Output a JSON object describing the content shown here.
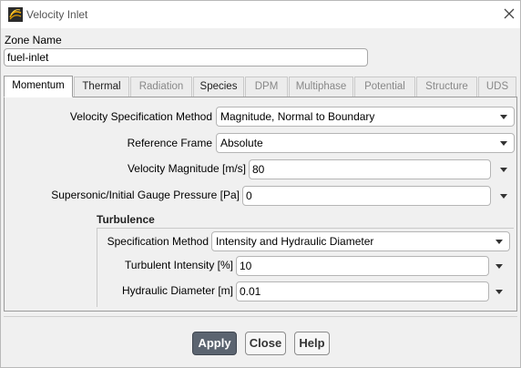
{
  "window": {
    "title": "Velocity Inlet",
    "icon": "fluent-app-icon",
    "close_icon": "close-icon"
  },
  "zone": {
    "label": "Zone Name",
    "value": "fuel-inlet"
  },
  "tabs": [
    {
      "label": "Momentum",
      "state": "active"
    },
    {
      "label": "Thermal",
      "state": "enabled"
    },
    {
      "label": "Radiation",
      "state": "disabled"
    },
    {
      "label": "Species",
      "state": "enabled"
    },
    {
      "label": "DPM",
      "state": "disabled"
    },
    {
      "label": "Multiphase",
      "state": "disabled"
    },
    {
      "label": "Potential",
      "state": "disabled"
    },
    {
      "label": "Structure",
      "state": "disabled"
    },
    {
      "label": "UDS",
      "state": "disabled"
    }
  ],
  "momentum": {
    "velocity_spec": {
      "label": "Velocity Specification Method",
      "value": "Magnitude, Normal to Boundary"
    },
    "reference_frame": {
      "label": "Reference Frame",
      "value": "Absolute"
    },
    "velocity_magnitude": {
      "label": "Velocity Magnitude [m/s]",
      "value": "80"
    },
    "gauge_pressure": {
      "label": "Supersonic/Initial Gauge Pressure [Pa]",
      "value": "0"
    },
    "turbulence": {
      "title": "Turbulence",
      "spec_method": {
        "label": "Specification Method",
        "value": "Intensity and Hydraulic Diameter"
      },
      "intensity": {
        "label": "Turbulent Intensity [%]",
        "value": "10"
      },
      "hydraulic_diameter": {
        "label": "Hydraulic Diameter [m]",
        "value": "0.01"
      }
    }
  },
  "buttons": {
    "apply": "Apply",
    "close": "Close",
    "help": "Help"
  },
  "colors": {
    "primary_button": "#5b6470",
    "tab_disabled_text": "#888888"
  }
}
